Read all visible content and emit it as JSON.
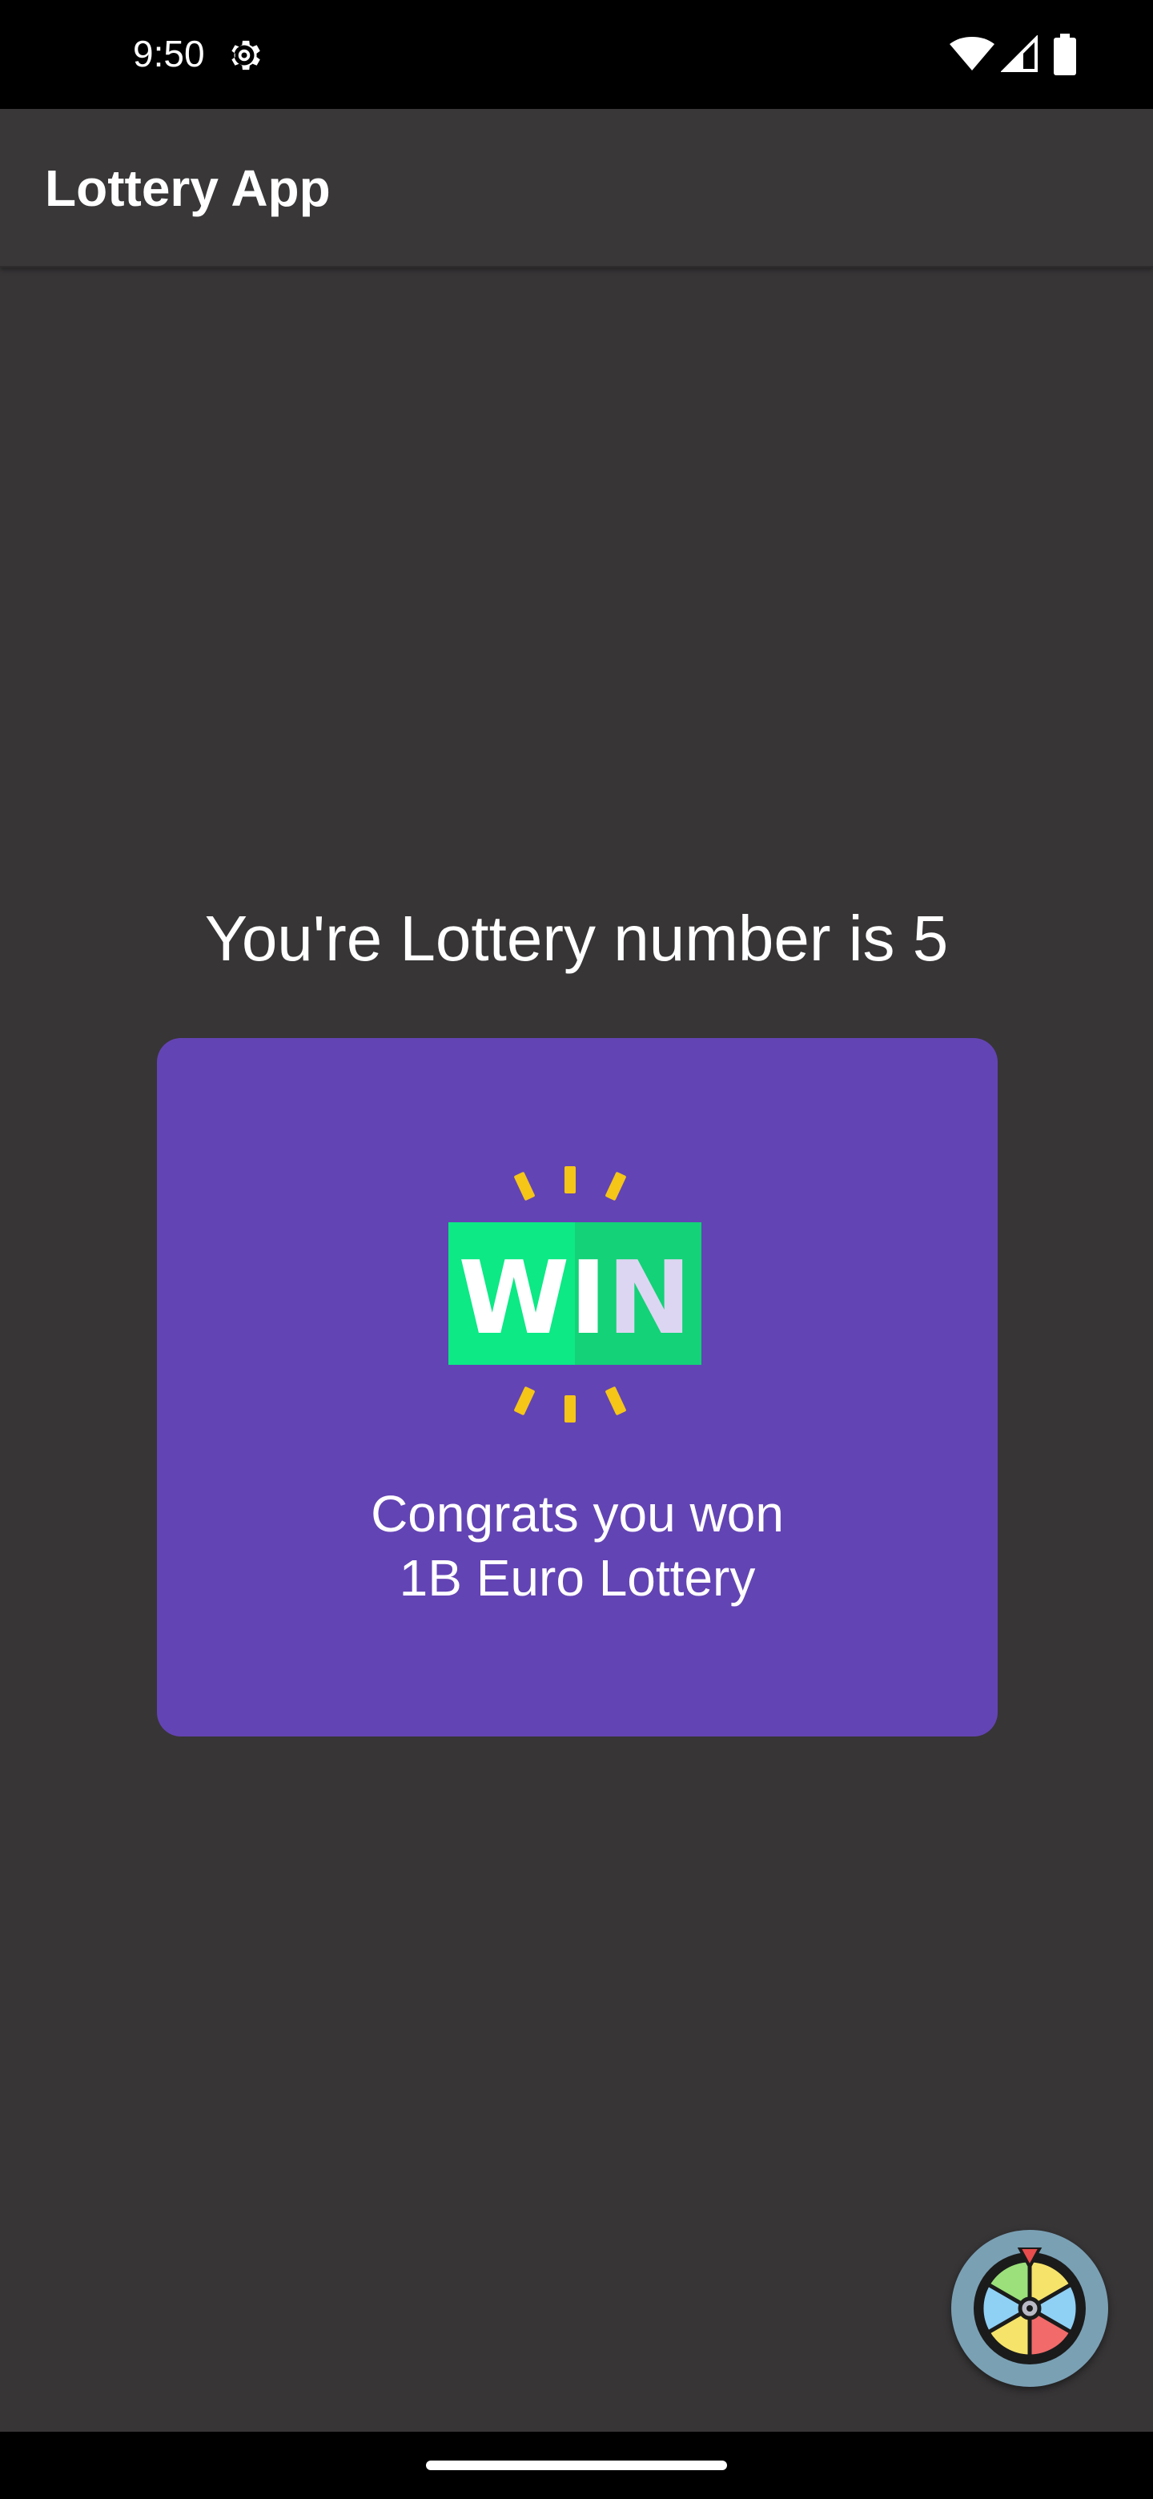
{
  "status_bar": {
    "time": "9:50",
    "icons": [
      "gear-icon",
      "wifi-icon",
      "signal-icon",
      "battery-icon"
    ]
  },
  "app_bar": {
    "title": "Lottery App"
  },
  "main": {
    "heading": "You're Lottery number is 5",
    "card": {
      "badge_text": "WIN",
      "message_line1": "Congrats you won",
      "message_line2": "1B Euro Lottery",
      "background_color": "#6344b4",
      "badge_color": "#13e27f",
      "ray_color": "#f5c518"
    }
  },
  "fab": {
    "icon": "spin-wheel-icon"
  },
  "colors": {
    "background": "#373536",
    "app_bar": "#393738",
    "status_bar": "#000000"
  }
}
